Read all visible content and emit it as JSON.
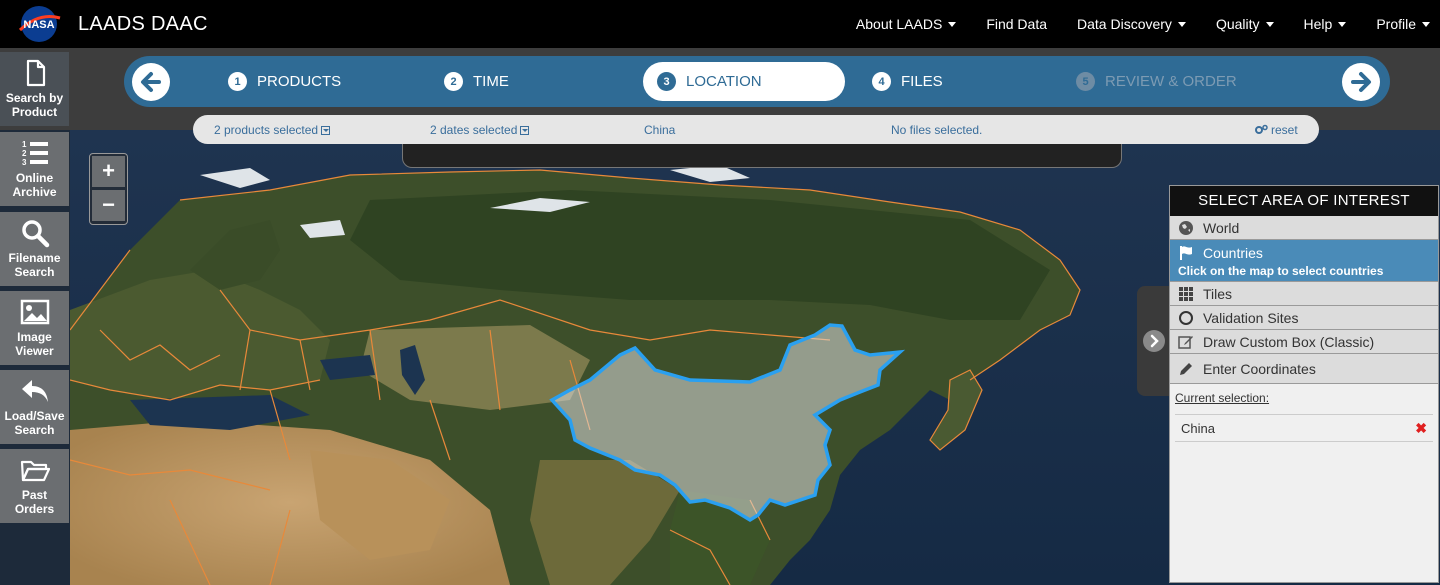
{
  "navbar": {
    "logo_text": "NASA",
    "brand": "LAADS DAAC",
    "menu": [
      {
        "label": "About LAADS",
        "dropdown": true
      },
      {
        "label": "Find Data",
        "dropdown": false
      },
      {
        "label": "Data Discovery",
        "dropdown": true
      },
      {
        "label": "Quality",
        "dropdown": true
      },
      {
        "label": "Help",
        "dropdown": true
      },
      {
        "label": "Profile",
        "dropdown": true
      }
    ]
  },
  "toolbar": {
    "items": [
      {
        "label": "Search by Product",
        "icon": "document-icon"
      },
      {
        "label": "Online Archive",
        "icon": "numbered-list-icon"
      },
      {
        "label": "Filename Search",
        "icon": "search-icon"
      },
      {
        "label": "Image Viewer",
        "icon": "image-icon"
      },
      {
        "label": "Load/Save Search",
        "icon": "reply-arrow-icon"
      },
      {
        "label": "Past Orders",
        "icon": "folder-open-icon"
      }
    ]
  },
  "wizard": {
    "steps": [
      {
        "num": "1",
        "label": "PRODUCTS",
        "state": "done"
      },
      {
        "num": "2",
        "label": "TIME",
        "state": "done"
      },
      {
        "num": "3",
        "label": "LOCATION",
        "state": "current"
      },
      {
        "num": "4",
        "label": "FILES",
        "state": "done"
      },
      {
        "num": "5",
        "label": "REVIEW & ORDER",
        "state": "disabled"
      }
    ]
  },
  "summary": {
    "products": "2 products selected",
    "dates": "2 dates selected",
    "location": "China",
    "files": "No files selected.",
    "reset": "reset"
  },
  "zoom": {
    "in": "+",
    "out": "−"
  },
  "aoi_panel": {
    "title": "SELECT AREA OF INTEREST",
    "options": [
      {
        "label": "World",
        "icon": "globe-icon"
      },
      {
        "label": "Countries",
        "icon": "flag-icon",
        "hint": "Click on the map to select countries"
      },
      {
        "label": "Tiles",
        "icon": "grid-icon"
      },
      {
        "label": "Validation Sites",
        "icon": "circle-icon"
      },
      {
        "label": "Draw Custom Box (Classic)",
        "icon": "edit-box-icon"
      },
      {
        "label": "Enter Coordinates",
        "icon": "pencil-icon"
      }
    ],
    "current_selection_label": "Current selection:",
    "current_selection": "China",
    "remove_symbol": "✖"
  },
  "colors": {
    "nav_bg": "#000000",
    "wizard_bg": "#2f6b95",
    "accent_link": "#3a6e9c",
    "border_orange": "#e8893a",
    "selection_blue": "#2aa0f0",
    "panel_active": "#4a8bb8"
  }
}
